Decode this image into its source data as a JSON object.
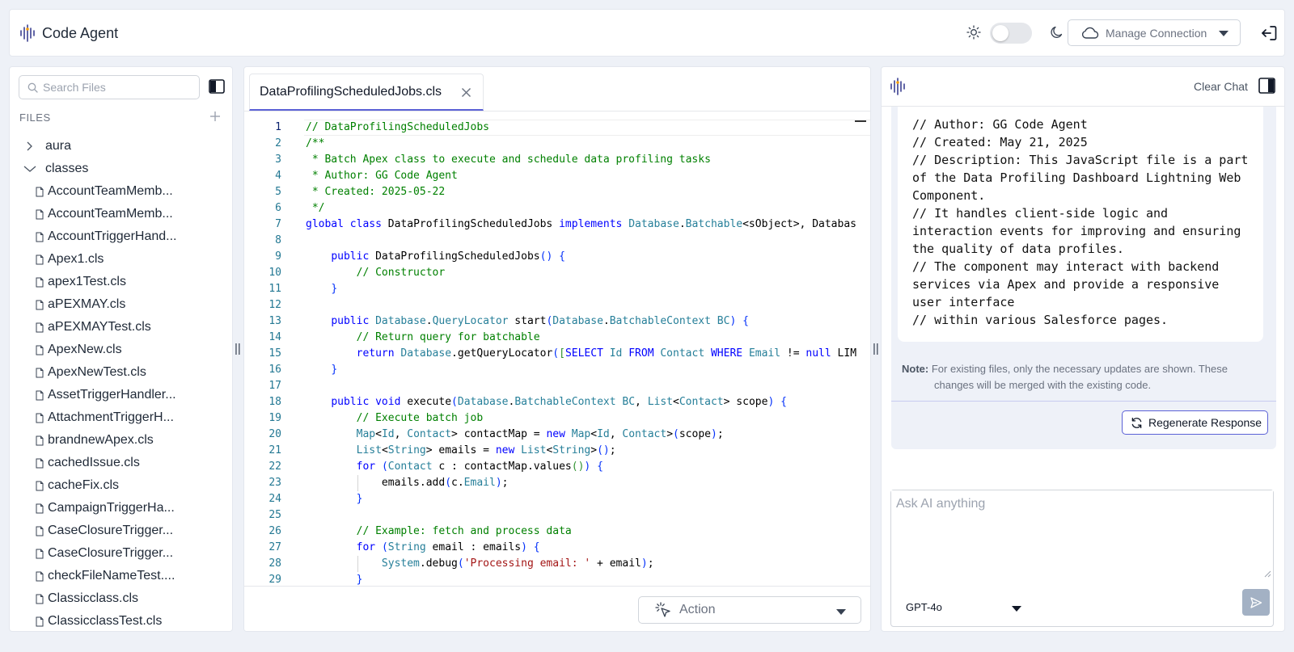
{
  "header": {
    "app_title": "Code Agent",
    "manage_connection_label": "Manage Connection",
    "theme": "light"
  },
  "sidebar": {
    "search_placeholder": "Search Files",
    "files_label": "FILES",
    "folders": [
      {
        "name": "aura",
        "expanded": false
      },
      {
        "name": "classes",
        "expanded": true
      }
    ],
    "files": [
      "AccountTeamMemb...",
      "AccountTeamMemb...",
      "AccountTriggerHand...",
      "Apex1.cls",
      "apex1Test.cls",
      "aPEXMAY.cls",
      "aPEXMAYTest.cls",
      "ApexNew.cls",
      "ApexNewTest.cls",
      "AssetTriggerHandler...",
      "AttachmentTriggerH...",
      "brandnewApex.cls",
      "cachedIssue.cls",
      "cacheFix.cls",
      "CampaignTriggerHa...",
      "CaseClosureTrigger...",
      "CaseClosureTrigger...",
      "checkFileNameTest....",
      "Classicclass.cls",
      "ClassicclassTest.cls"
    ]
  },
  "splitter_glyph": "||",
  "editor": {
    "tab_name": "DataProfilingScheduledJobs.cls",
    "active_line": 1,
    "code_lines": [
      "// DataProfilingScheduledJobs",
      "/**",
      " * Batch Apex class to execute and schedule data profiling tasks",
      " * Author: GG Code Agent",
      " * Created: 2025-05-22",
      " */",
      "global class DataProfilingScheduledJobs implements Database.Batchable<sObject>, Databas",
      "",
      "    public DataProfilingScheduledJobs() {",
      "        // Constructor",
      "    }",
      "",
      "    public Database.QueryLocator start(Database.BatchableContext BC) {",
      "        // Return query for batchable",
      "        return Database.getQueryLocator([SELECT Id FROM Contact WHERE Email != null LIM",
      "    }",
      "",
      "    public void execute(Database.BatchableContext BC, List<Contact> scope) {",
      "        // Execute batch job",
      "        Map<Id, Contact> contactMap = new Map<Id, Contact>(scope);",
      "        List<String> emails = new List<String>();",
      "        for (Contact c : contactMap.values()) {",
      "            emails.add(c.Email);",
      "        }",
      "",
      "        // Example: fetch and process data",
      "        for (String email : emails) {",
      "            System.debug('Processing email: ' + email);",
      "        }"
    ],
    "action_label": "Action"
  },
  "chat": {
    "clear_chat_label": "Clear Chat",
    "message_lines": [
      "// Author: GG Code Agent",
      "// Created: May 21, 2025",
      "// Description: This JavaScript file is a part of the Data Profiling Dashboard Lightning Web Component.",
      "// It handles client-side logic and interaction events for improving and ensuring the quality of data profiles.",
      "// The component may interact with backend services via Apex and provide a responsive user interface",
      "// within various Salesforce pages."
    ],
    "note_label": "Note:",
    "note_text": "For existing files, only the necessary updates are shown. These changes will be merged with the existing code.",
    "regenerate_label": "Regenerate Response",
    "input_placeholder": "Ask AI anything",
    "model": "GPT-4o"
  },
  "colors": {
    "accent": "#5b61d6",
    "comment": "#008000",
    "keyword": "#0000ff",
    "type": "#267f99",
    "string": "#a31515",
    "send_button": "#a3b1c4"
  }
}
